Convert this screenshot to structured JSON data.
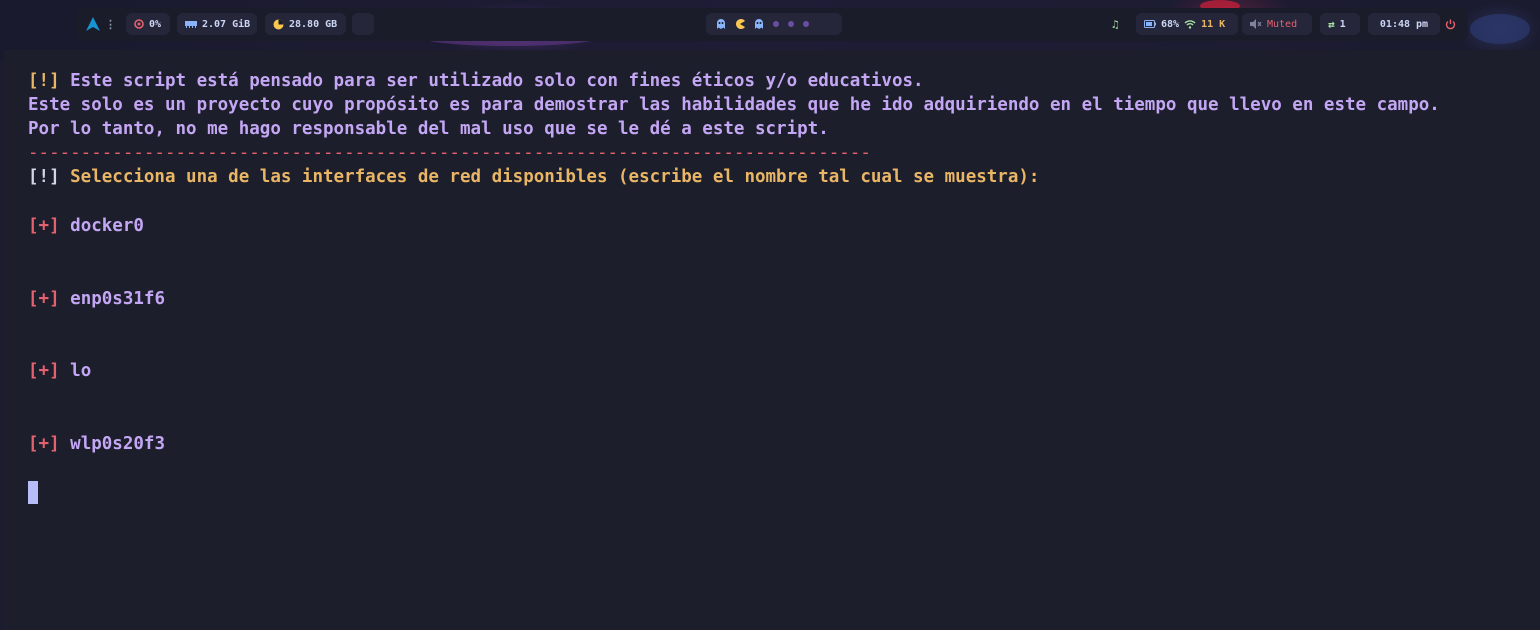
{
  "topbar": {
    "launcher_icon": "arch-icon",
    "menu_icon": "kebab-menu-icon",
    "cpu": {
      "icon": "cpu-icon",
      "value": "0%"
    },
    "memory": {
      "icon": "memory-icon",
      "value": "2.07 GiB"
    },
    "disk": {
      "icon": "disk-pie-icon",
      "value": "28.80 GB"
    },
    "workspaces": [
      "ghost-icon",
      "pacman-icon",
      "ghost-icon",
      "dot",
      "dot",
      "dot"
    ],
    "music_icon": "music-note-icon",
    "battery": {
      "icon": "battery-icon",
      "value": "68%"
    },
    "wifi": {
      "icon": "wifi-icon",
      "value": "11 K"
    },
    "volume": {
      "icon": "speaker-muted-icon",
      "value": "Muted"
    },
    "updates": {
      "icon": "updates-icon",
      "value": "1"
    },
    "clock": "01:48 pm",
    "power_icon": "power-icon",
    "colors": {
      "accent": "#1793d1",
      "muted": "#e5616d",
      "wifi": "#e8b665",
      "updates": "#a6e3a1"
    }
  },
  "terminal": {
    "warning_prefix": "[!]",
    "disclaimer": [
      " Este script está pensado para ser utilizado solo con fines éticos y/o educativos.",
      "Este solo es un proyecto cuyo propósito es para demostrar las habilidades que he ido adquiriendo en el tiempo que llevo en este campo.",
      "Por lo tanto, no me hago responsable del mal uso que se le dé a este script."
    ],
    "separator": "--------------------------------------------------------------------------------",
    "prompt_prefix": "[!]",
    "prompt": " Selecciona una de las interfaces de red disponibles (escribe el nombre tal cual se muestra):",
    "item_prefix": "[+]",
    "interfaces": [
      "docker0",
      "enp0s31f6",
      "lo",
      "wlp0s20f3"
    ],
    "colors": {
      "yellow": "#e8b665",
      "purple": "#c4a7f4",
      "red": "#e5616d",
      "cursor": "#b7bdf8"
    }
  }
}
